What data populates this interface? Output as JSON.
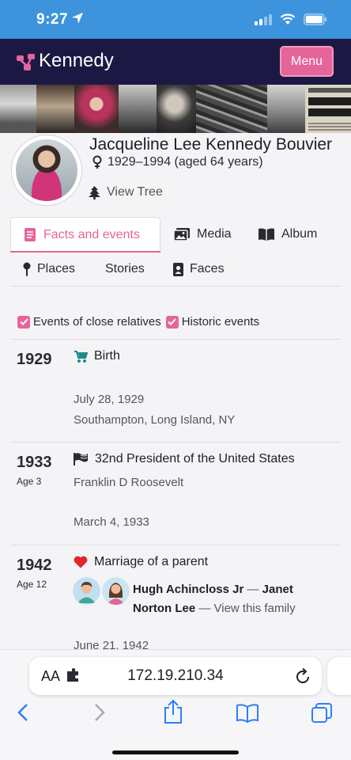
{
  "status": {
    "time": "9:27"
  },
  "header": {
    "brand": "Kennedy",
    "menu_label": "Menu"
  },
  "person": {
    "name": "Jacqueline Lee Kennedy Bouvier",
    "lifespan": "1929–1994 (aged 64 years)",
    "view_tree": "View Tree"
  },
  "tabs": [
    {
      "label": "Facts and events",
      "icon": "document-icon",
      "active": true
    },
    {
      "label": "Media",
      "icon": "image-icon"
    },
    {
      "label": "Album",
      "icon": "book-icon"
    }
  ],
  "subtabs": [
    {
      "label": "Places",
      "icon": "pin-icon"
    },
    {
      "label": "Stories"
    },
    {
      "label": "Faces",
      "icon": "contact-icon"
    }
  ],
  "filters": [
    {
      "label": "Events of close relatives",
      "checked": true
    },
    {
      "label": "Historic events",
      "checked": true
    }
  ],
  "events": [
    {
      "year": "1929",
      "age": "",
      "icon": "stroller-icon",
      "title": "Birth",
      "line1": "",
      "date": "July 28, 1929",
      "place": "Southampton, Long Island, NY"
    },
    {
      "year": "1933",
      "age": "Age 3",
      "icon": "flag-icon",
      "title": "32nd President of the United States",
      "line1": "Franklin D Roosevelt",
      "date": "March 4, 1933",
      "place": ""
    },
    {
      "year": "1942",
      "age": "Age 12",
      "icon": "heart-icon",
      "title": "Marriage of a parent",
      "family": {
        "person1": "Hugh Achincloss Jr",
        "sep": " — ",
        "person2": "Janet Norton Lee",
        "link": "View this family"
      },
      "date": "June 21, 1942"
    }
  ],
  "browser": {
    "aa_label": "AA",
    "url": "172.19.210.34"
  },
  "colors": {
    "accent": "#e5649a",
    "navy": "#1b1944",
    "status_blue": "#3d94dd",
    "heart": "#e0262e",
    "teal": "#1f8a8a"
  }
}
